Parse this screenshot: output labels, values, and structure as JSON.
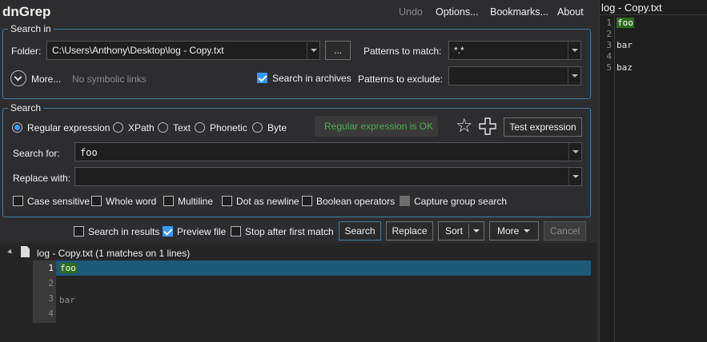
{
  "app": {
    "title": "dnGrep"
  },
  "menu": {
    "undo": "Undo",
    "options": "Options...",
    "bookmarks": "Bookmarks...",
    "about": "About"
  },
  "search_in": {
    "legend": "Search in",
    "folder_label": "Folder:",
    "folder_value": "C:\\Users\\Anthony\\Desktop\\log - Copy.txt",
    "browse_label": "...",
    "patterns_match_label": "Patterns to match:",
    "patterns_match_value": "*.*",
    "more_label": "More...",
    "symlinks_label": "No symbolic links",
    "archives_label": "Search in archives",
    "patterns_exclude_label": "Patterns to exclude:",
    "patterns_exclude_value": ""
  },
  "search": {
    "legend": "Search",
    "modes": [
      "Regular expression",
      "XPath",
      "Text",
      "Phonetic",
      "Byte"
    ],
    "selected_mode": "Regular expression",
    "status": "Regular expression is OK",
    "test_label": "Test expression",
    "search_for_label": "Search for:",
    "search_for_value": "foo",
    "replace_label": "Replace with:",
    "replace_value": "",
    "options": [
      {
        "label": "Case sensitive",
        "checked": false
      },
      {
        "label": "Whole word",
        "checked": false
      },
      {
        "label": "Multiline",
        "checked": false
      },
      {
        "label": "Dot as newline",
        "checked": false
      },
      {
        "label": "Boolean operators",
        "checked": false
      },
      {
        "label": "Capture group search",
        "checked": false,
        "disabled": true
      }
    ]
  },
  "actions": {
    "search_in_results": "Search in results",
    "preview_file": "Preview file",
    "stop_after_first": "Stop after first match",
    "search_btn": "Search",
    "replace_btn": "Replace",
    "sort_btn": "Sort",
    "more_btn": "More",
    "cancel_btn": "Cancel"
  },
  "results": {
    "file_entry": "log - Copy.txt (1 matches on 1 lines)",
    "lines": [
      {
        "num": "1",
        "text": "foo",
        "match": true
      },
      {
        "num": "2",
        "text": "",
        "match": false
      },
      {
        "num": "3",
        "text": "bar",
        "match": false
      },
      {
        "num": "4",
        "text": "",
        "match": false
      }
    ]
  },
  "preview": {
    "title": "log - Copy.txt",
    "lines": [
      {
        "num": "1",
        "text": "foo",
        "match": true
      },
      {
        "num": "2",
        "text": "",
        "match": false
      },
      {
        "num": "3",
        "text": "bar",
        "match": false
      },
      {
        "num": "4",
        "text": "",
        "match": false
      },
      {
        "num": "5",
        "text": "baz",
        "match": false
      }
    ]
  },
  "colors": {
    "accent": "#3399ff",
    "border": "#3e7ea6",
    "status_green": "#4caf50",
    "match_bg": "#2e6b1f",
    "selected_row": "#1d5a78"
  }
}
